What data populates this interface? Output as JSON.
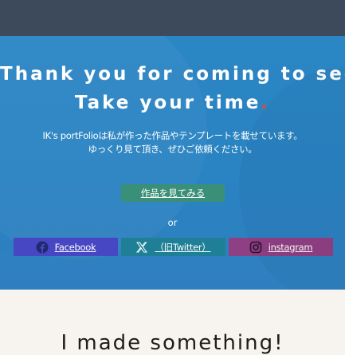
{
  "hero": {
    "headline_line1": "Thank you for coming to see",
    "headline_line1_dot": ".",
    "headline_line2": "Take your time",
    "headline_line2_dot": ".",
    "description_line1": "IK's portFolioは私が作った作品やテンプレートを載せています。",
    "description_line2": "ゆっくり見て頂き、ぜひご依頼ください。",
    "works_button_label": "作品を見てみる",
    "or_label": "or",
    "social": {
      "facebook_label": "Facebook",
      "twitter_label": "（旧Twitter）",
      "instagram_label": "instagram"
    }
  },
  "next_section": {
    "heading_partial": "I made something!"
  },
  "colors": {
    "topbar": "#3c4a5c",
    "hero_bg": "#2b86c4",
    "accent_dot": "#e5473a",
    "works_button": "#3a8f78",
    "facebook": "#4747c4",
    "twitter": "#1f7f96",
    "instagram": "#8f3f84",
    "page_bg": "#f7f3ee"
  },
  "icons": {
    "facebook": "facebook-icon",
    "twitter": "x-icon",
    "instagram": "instagram-icon"
  }
}
